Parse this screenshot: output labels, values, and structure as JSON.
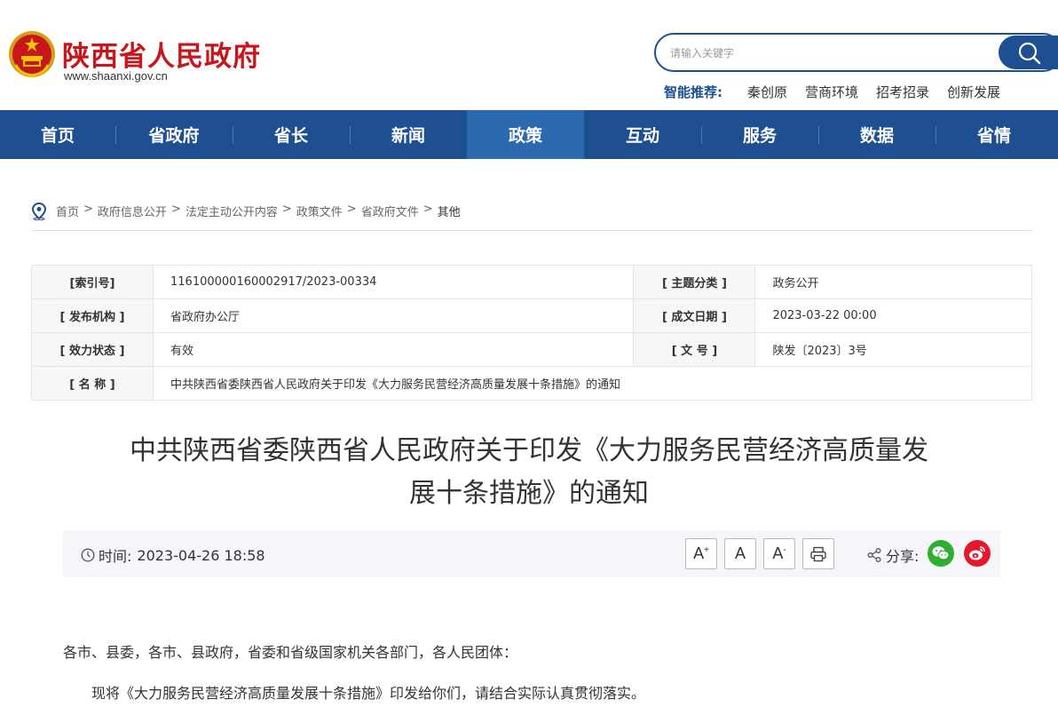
{
  "header": {
    "site_title": "陕西省人民政府",
    "site_url": "www.shaanxi.gov.cn",
    "search_placeholder": "请输入关键字",
    "hot_label": "智能推荐:",
    "hot_items": [
      "秦创原",
      "营商环境",
      "招考招录",
      "创新发展"
    ]
  },
  "nav": [
    "首页",
    "省政府",
    "省长",
    "新闻",
    "政策",
    "互动",
    "服务",
    "数据",
    "省情"
  ],
  "nav_active": "政策",
  "breadcrumb": [
    "首页",
    "政府信息公开",
    "法定主动公开内容",
    "政策文件",
    "省政府文件",
    "其他"
  ],
  "info": {
    "index_label": "[索引号]",
    "index_value": "116100000160002917/2023-00334",
    "topic_label": "[ 主题分类 ]",
    "topic_value": "政务公开",
    "org_label": "[ 发布机构 ]",
    "org_value": "省政府办公厅",
    "date_label": "[ 成文日期 ]",
    "date_value": "2023-03-22 00:00",
    "status_label": "[ 效力状态 ]",
    "status_value": "有效",
    "docno_label": "[ 文 号 ]",
    "docno_value": "陕发〔2023〕3号",
    "name_label": "[ 名 称 ]",
    "name_value": "中共陕西省委陕西省人民政府关于印发《大力服务民营经济高质量发展十条措施》的通知"
  },
  "article": {
    "title_line1": "中共陕西省委陕西省人民政府关于印发《大力服务民营经济高质量发",
    "title_line2": "展十条措施》的通知",
    "time_label": "时间:",
    "time_value": "2023-04-26 18:58",
    "font_large": "A",
    "font_large_sup": "+",
    "font_normal": "A",
    "font_small": "A",
    "font_small_sup": "-",
    "share_label": "分享:",
    "para1": "各市、县委，各市、县政府，省委和省级国家机关各部门，各人民团体：",
    "para2": "现将《大力服务民营经济高质量发展十条措施》印发给你们，请结合实际认真贯彻落实。"
  },
  "colors": {
    "brand_blue": "#1d4f91",
    "brand_red": "#c8161d",
    "wechat_green": "#2db030",
    "weibo_red": "#e6162d"
  }
}
